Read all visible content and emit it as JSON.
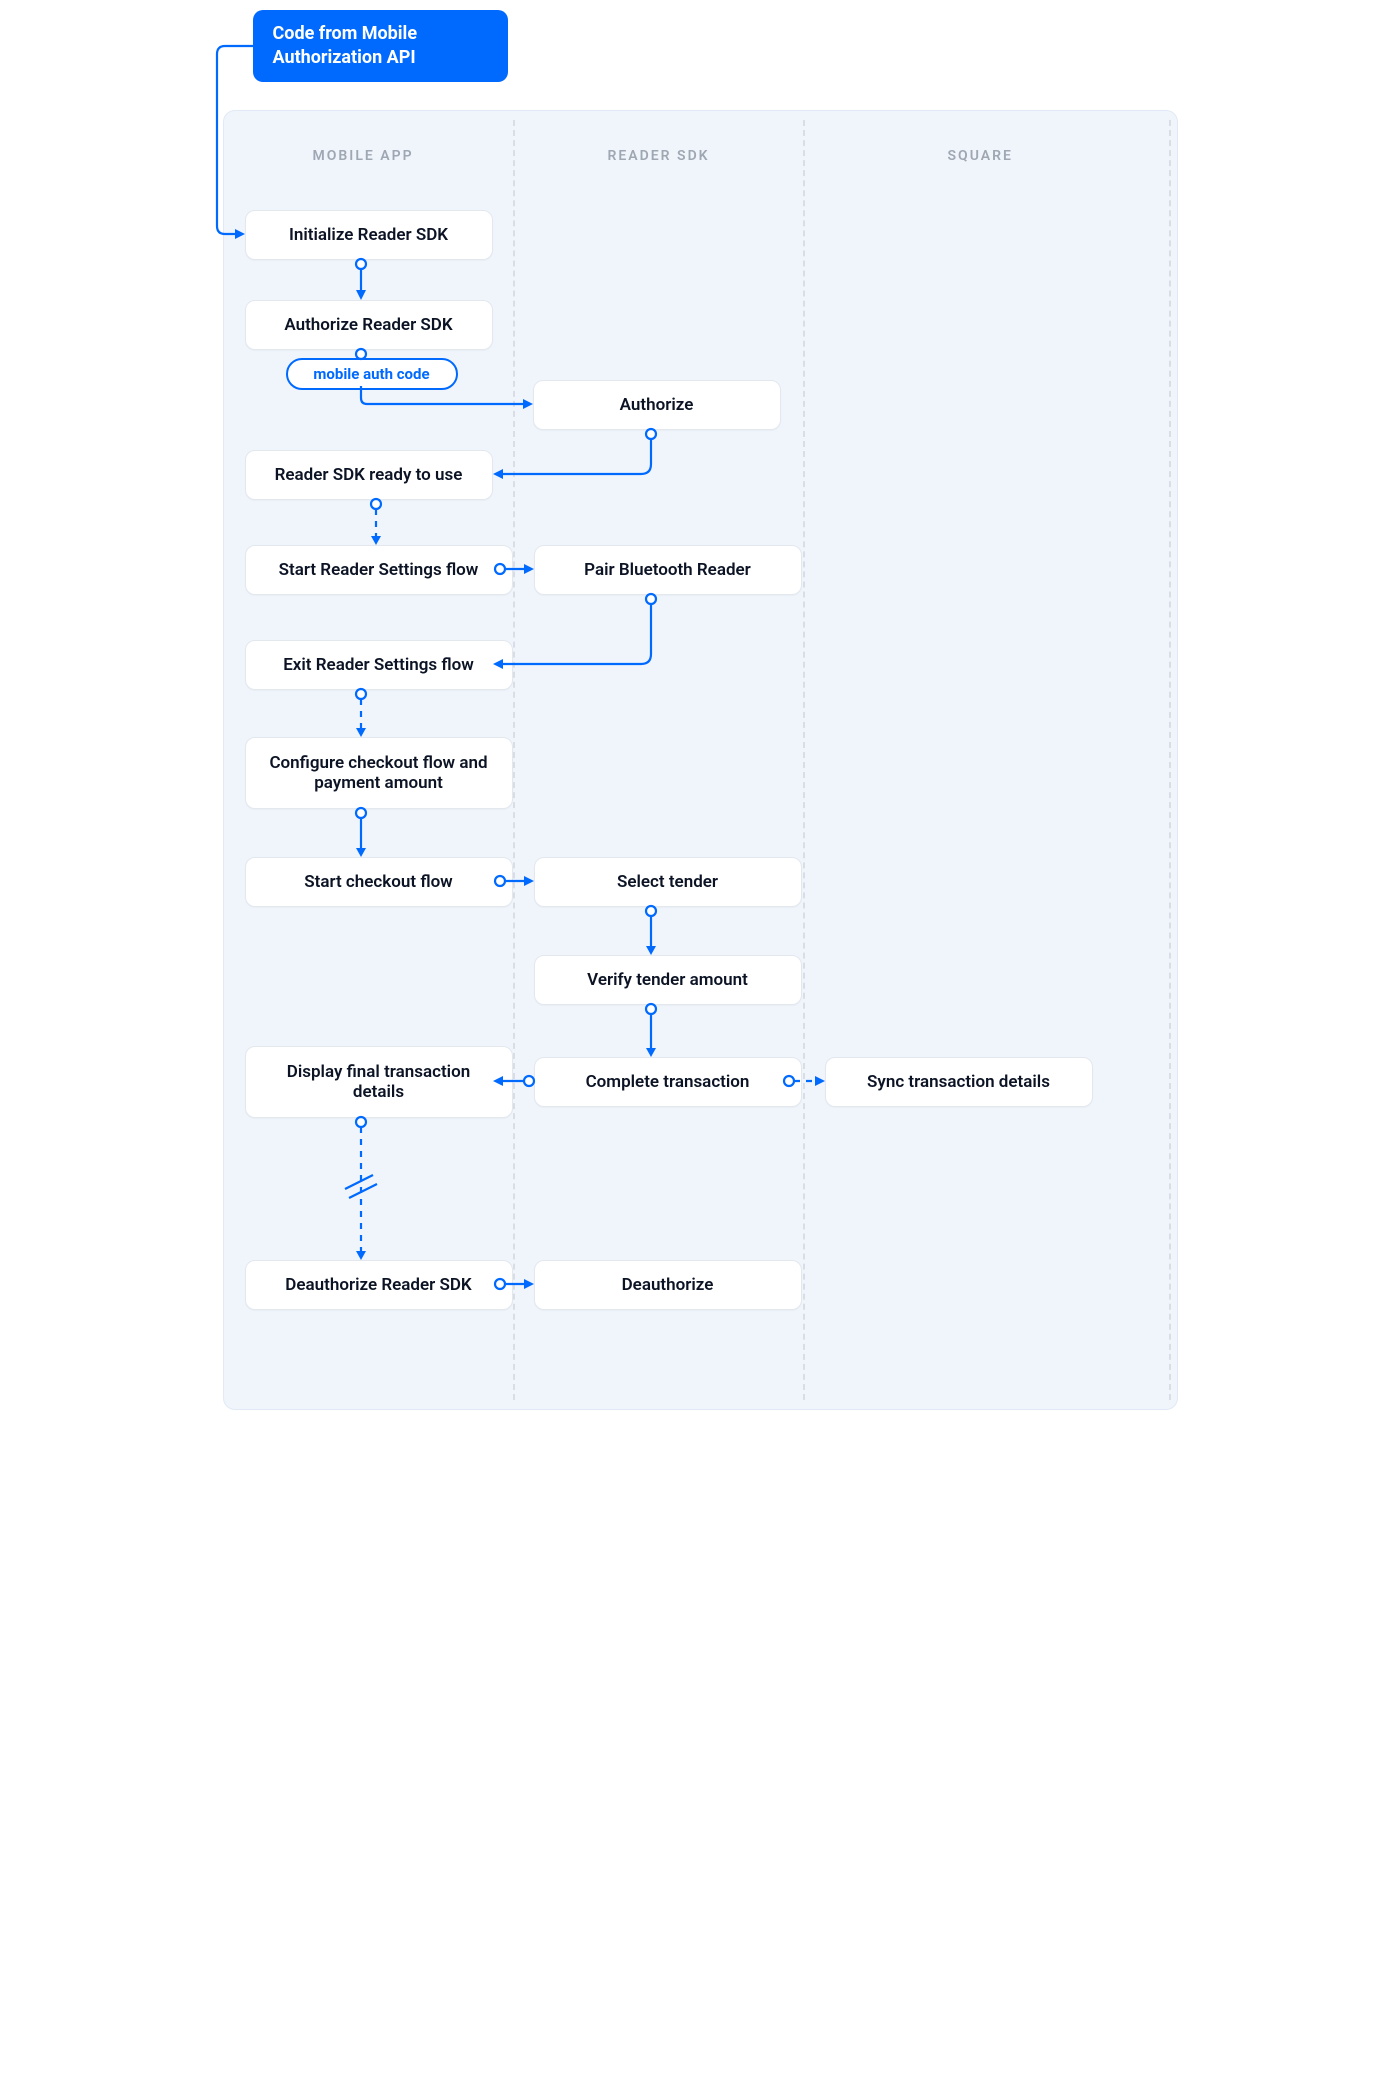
{
  "cols": {
    "mobile_app": "MOBILE APP",
    "reader_sdk": "READER SDK",
    "square": "SQUARE"
  },
  "nodes": {
    "start": "Code from Mobile\nAuthorization API",
    "init": "Initialize Reader SDK",
    "auth": "Authorize Reader SDK",
    "pill_auth_code": "mobile auth code",
    "sdk_authorize": "Authorize",
    "ready": "Reader SDK ready to use",
    "start_settings": "Start Reader Settings flow",
    "pair": "Pair Bluetooth Reader",
    "exit_settings": "Exit Reader Settings flow",
    "configure": "Configure checkout flow and payment amount",
    "start_checkout": "Start checkout flow",
    "select_tender": "Select tender",
    "verify_tender": "Verify tender amount",
    "display_final": "Display final transaction details",
    "complete_txn": "Complete transaction",
    "sync_txn": "Sync transaction details",
    "deauth": "Deauthorize Reader SDK",
    "sdk_deauth": "Deauthorize"
  }
}
